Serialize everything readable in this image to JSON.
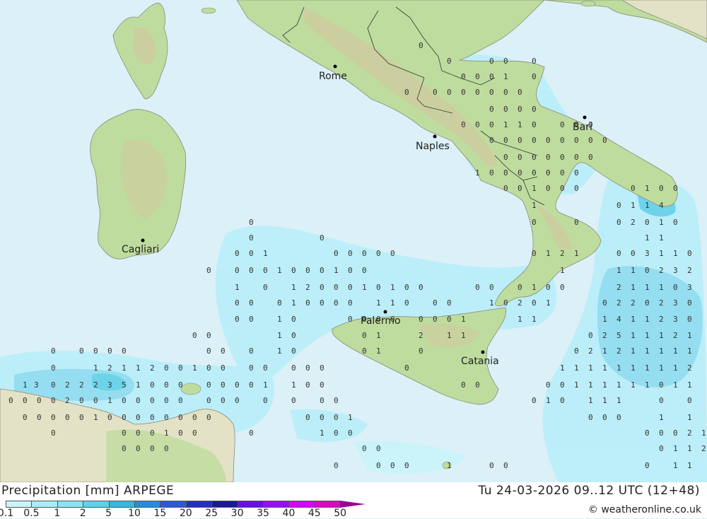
{
  "footer": {
    "title": "Precipitation [mm] ARPEGE",
    "time": "Tu 24-03-2026 09..12 UTC (12+48)",
    "credit": "© weatheronline.co.uk"
  },
  "legend": [
    {
      "label": "0.1",
      "color": "#c8f4fa"
    },
    {
      "label": "0.5",
      "color": "#a8eef8"
    },
    {
      "label": "1",
      "color": "#88e4f2"
    },
    {
      "label": "2",
      "color": "#62d0ea"
    },
    {
      "label": "5",
      "color": "#3cb4e0"
    },
    {
      "label": "10",
      "color": "#2c8ad8"
    },
    {
      "label": "15",
      "color": "#2a5cd0"
    },
    {
      "label": "20",
      "color": "#2232b0"
    },
    {
      "label": "25",
      "color": "#1a1a8e"
    },
    {
      "label": "30",
      "color": "#6a10d8"
    },
    {
      "label": "35",
      "color": "#9a10e8"
    },
    {
      "label": "40",
      "color": "#c810e8"
    },
    {
      "label": "45",
      "color": "#d010c0"
    },
    {
      "label": "50",
      "color": "#b010a0"
    }
  ],
  "cities": [
    {
      "name": "Rome"
    },
    {
      "name": "Naples"
    },
    {
      "name": "Bari"
    },
    {
      "name": "Cagliari"
    },
    {
      "name": "Palermo"
    },
    {
      "name": "Catania"
    }
  ],
  "colors": {
    "sea": "#dcf0f8",
    "land": "#bedc9e",
    "hills": "#d4c6a0",
    "rain_light": "#b8eef8",
    "rain_mid": "#8edcf0"
  }
}
